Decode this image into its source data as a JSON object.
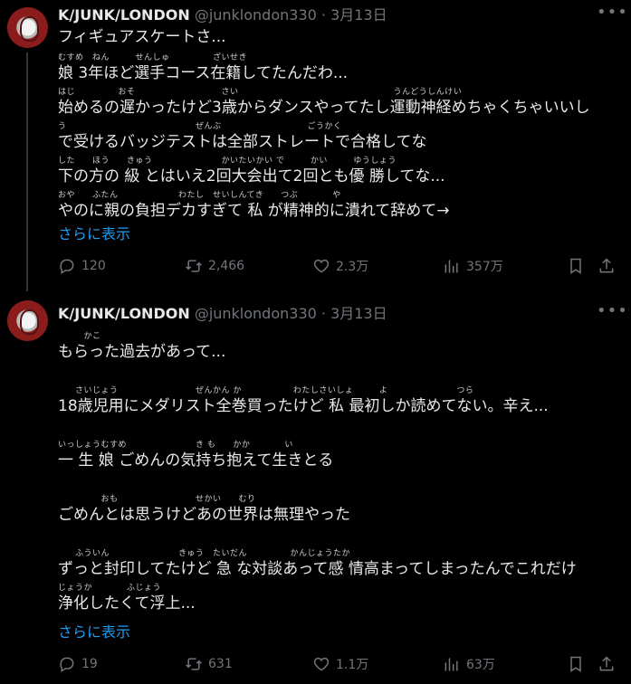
{
  "tweets": [
    {
      "author_name": "K/JUNK/LONDON",
      "handle_date": "@junklondon330 · 3月13日",
      "more_icon": "more-icon",
      "lines": [
        {
          "ruby": "",
          "text": "フィギュアスケートさ..."
        },
        {
          "ruby": "むすめ　ねん　　　せんしゅ　　　　　ざいせき",
          "text": " 娘 3年ほど選手コース在籍してたんだわ..."
        },
        {
          "ruby": "はじ　　　　　おそ　　　　　　　　　　さい　　　　　　　　　　　　　　　　　　うんどうしんけい",
          "text": "始めるの遅かったけど3歳からダンスやってたし運動神経めちゃくちゃいいし"
        },
        {
          "ruby": "う　　　　　　　　　　　　　　　ぜんぶ　　　　　　　　　　ごうかく",
          "text": "で受けるバッジテストは全部ストレートで合格してな"
        },
        {
          "ruby": "した　　ほう　　きゅう　　　　　　　　かいたいかい で　　　かい　　　ゆうしょう",
          "text": "下の方の 級 とはいえ2回大会出て2回とも優 勝してな..."
        },
        {
          "ruby": "おや　　ふたん　　　　　　　わたし　せいしんてき　　つぶ　　　　や",
          "text": "やのに親の負担デカすぎて 私 が精神的に潰れて辞めて→"
        }
      ],
      "show_more": "さらに表示",
      "stats": {
        "replies": "120",
        "retweets": "2,466",
        "likes": "2.3万",
        "views": "357万"
      }
    },
    {
      "author_name": "K/JUNK/LONDON",
      "handle_date": "@junklondon330 · 3月13日",
      "more_icon": "more-icon",
      "lines": [
        {
          "ruby": "　　　かこ",
          "text": "もらった過去があって..."
        },
        {
          "ruby": "",
          "text": ""
        },
        {
          "ruby": "　　さいじょう　　　　　　　　　ぜんかん か　　　　　　わたしさいしょ　　　よ　　　　　　　　つら",
          "text": "18歳児用にメダリスト全巻買ったけど 私 最初しか読めてない。辛え..."
        },
        {
          "ruby": "",
          "text": ""
        },
        {
          "ruby": "いっしょうむすめ　　　　　　　　き も　　かか　　　　い",
          "text": "一 生 娘 ごめんの気持ち抱えて生きとる"
        },
        {
          "ruby": "",
          "text": ""
        },
        {
          "ruby": "　　　　　おも　　　　　　　　　せかい　　むり",
          "text": "ごめんとは思うけどあの世界は無理やった"
        },
        {
          "ruby": "",
          "text": ""
        },
        {
          "ruby": "　　ふういん　　　　　　　　きゅう　たいだん　　　　　かんじょうたか",
          "text": "ずっと封印してたけど 急 な対談あって感 情高まってしまったんでこれだけ"
        },
        {
          "ruby": "じょうか　　　　ふじょう",
          "text": "浄化したくて浮上..."
        }
      ],
      "show_more": "さらに表示",
      "stats": {
        "replies": "19",
        "retweets": "631",
        "likes": "1.1万",
        "views": "63万"
      }
    }
  ],
  "icons": {
    "reply": "reply-icon",
    "retweet": "retweet-icon",
    "like": "heart-icon",
    "views": "views-icon",
    "bookmark": "bookmark-icon",
    "share": "share-icon"
  }
}
